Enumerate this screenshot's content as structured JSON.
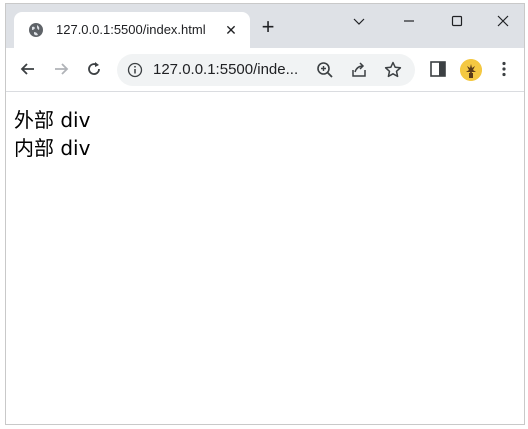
{
  "tab": {
    "title": "127.0.0.1:5500/index.html",
    "favicon_icon": "globe-icon",
    "close_label": "✕"
  },
  "new_tab_label": "+",
  "window_controls": [
    "chevron-down-icon",
    "minimize-icon",
    "maximize-icon",
    "close-icon"
  ],
  "toolbar": {
    "back_icon": "back-arrow-icon",
    "forward_icon": "forward-arrow-icon",
    "reload_icon": "reload-icon",
    "omnibox": {
      "info_icon": "info-icon",
      "url": "127.0.0.1:5500/inde...",
      "zoom_icon": "zoom-icon",
      "share_icon": "share-icon",
      "bookmark_icon": "star-icon"
    },
    "side_panel_icon": "side-panel-icon",
    "profile_icon": "avatar",
    "menu_icon": "more-vertical-icon"
  },
  "page": {
    "lines": [
      "外部 div",
      "内部 div"
    ]
  },
  "colors": {
    "tabstrip_bg": "#dee1e6",
    "omnibox_bg": "#f1f3f4",
    "text": "#202124",
    "avatar_bg": "#f4c842"
  }
}
